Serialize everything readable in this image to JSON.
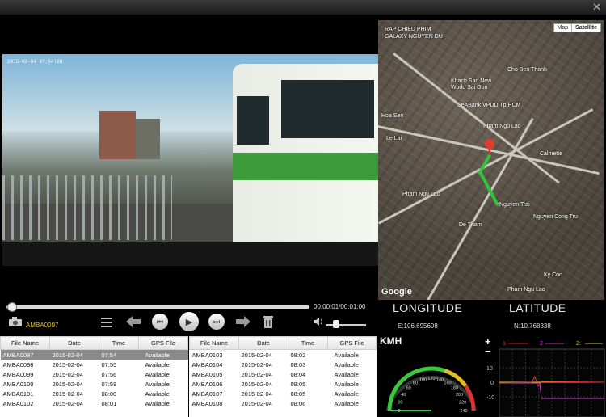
{
  "video": {
    "timestamp": "2015-02-04 07:54:28"
  },
  "map": {
    "map_button": "Map",
    "satellite_button": "Satellite",
    "logo": "Google",
    "labels": [
      "RAP CHIEU PHIM",
      "GALAXY NGUYEN DU",
      "Cho Ben Thanh",
      "Khach San New",
      "World Sai Gon",
      "SeABank VPDD Tp.HCM",
      "Hoa Sen",
      "Pham Ngu Lao",
      "Le Lai",
      "Pham Ngu Lao",
      "De Tham",
      "Nguyen Trai",
      "Calmette",
      "Nguyen Cong Tru",
      "Ky Con",
      "Pham Ngu Lao"
    ]
  },
  "playback": {
    "time": "00:00:01/00:01:00",
    "position_fraction": 0.01
  },
  "camera": {
    "label": "AMBA0097"
  },
  "gps": {
    "longitude_label": "LONGITUDE",
    "latitude_label": "LATITUDE",
    "longitude": "E:106.695698",
    "latitude": "N:10.768338"
  },
  "file_table": {
    "headers": [
      "File Name",
      "Date",
      "Time",
      "GPS File"
    ],
    "left": [
      [
        "AMBA0097",
        "2015-02-04",
        "07:54",
        "Available"
      ],
      [
        "AMBA0098",
        "2015-02-04",
        "07:55",
        "Available"
      ],
      [
        "AMBA0099",
        "2015-02-04",
        "07:56",
        "Available"
      ],
      [
        "AMBA0100",
        "2015-02-04",
        "07:59",
        "Available"
      ],
      [
        "AMBA0101",
        "2015-02-04",
        "08:00",
        "Available"
      ],
      [
        "AMBA0102",
        "2015-02-04",
        "08:01",
        "Available"
      ]
    ],
    "right": [
      [
        "AMBA0103",
        "2015-02-04",
        "08:02",
        "Available"
      ],
      [
        "AMBA0104",
        "2015-02-04",
        "08:03",
        "Available"
      ],
      [
        "AMBA0105",
        "2015-02-04",
        "08:04",
        "Available"
      ],
      [
        "AMBA0106",
        "2015-02-04",
        "08:05",
        "Available"
      ],
      [
        "AMBA0107",
        "2015-02-04",
        "08:05",
        "Available"
      ],
      [
        "AMBA0108",
        "2015-02-04",
        "08:06",
        "Available"
      ]
    ],
    "selected_index": 0
  },
  "speedometer": {
    "unit": "KMH",
    "ticks": [
      "0",
      "20",
      "40",
      "60",
      "80",
      "100",
      "120",
      "140",
      "160",
      "180",
      "200",
      "220",
      "240"
    ],
    "value": 0
  },
  "gsensor": {
    "legend": [
      "1",
      "2",
      "2:"
    ],
    "y_ticks": [
      "10",
      "0",
      "-10"
    ],
    "colors": [
      "#e03030",
      "#d040d0",
      "#e0c020"
    ]
  },
  "zoom": {
    "plus": "+",
    "minus": "−"
  }
}
